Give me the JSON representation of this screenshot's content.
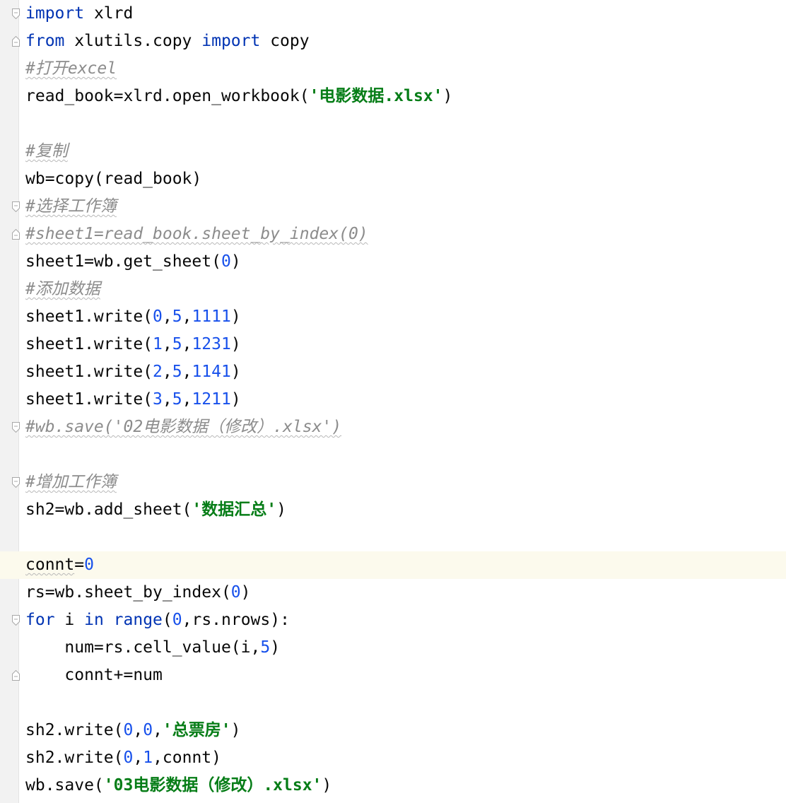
{
  "editor": {
    "lines": [
      {
        "fold": "start",
        "current": false,
        "tokens": [
          {
            "t": "import",
            "c": "kw"
          },
          {
            "t": " xlrd",
            "c": "plain"
          }
        ]
      },
      {
        "fold": "end",
        "current": false,
        "tokens": [
          {
            "t": "from",
            "c": "kw"
          },
          {
            "t": " xlutils.copy ",
            "c": "plain"
          },
          {
            "t": "import",
            "c": "kw"
          },
          {
            "t": " copy",
            "c": "plain"
          }
        ]
      },
      {
        "fold": "",
        "current": false,
        "tokens": [
          {
            "t": "#打开excel",
            "c": "cmt wavy"
          }
        ]
      },
      {
        "fold": "",
        "current": false,
        "tokens": [
          {
            "t": "read_book=xlrd.open_workbook(",
            "c": "plain"
          },
          {
            "t": "'电影数据.xlsx'",
            "c": "str"
          },
          {
            "t": ")",
            "c": "plain"
          }
        ]
      },
      {
        "fold": "",
        "current": false,
        "tokens": []
      },
      {
        "fold": "",
        "current": false,
        "tokens": [
          {
            "t": "#复制",
            "c": "cmt wavy"
          }
        ]
      },
      {
        "fold": "",
        "current": false,
        "tokens": [
          {
            "t": "wb=copy(read_book)",
            "c": "plain"
          }
        ]
      },
      {
        "fold": "start",
        "current": false,
        "tokens": [
          {
            "t": "#选择工作簿",
            "c": "cmt wavy"
          }
        ]
      },
      {
        "fold": "end",
        "current": false,
        "tokens": [
          {
            "t": "#sheet1=read_book.sheet_by_index(0)",
            "c": "cmt wavy"
          }
        ]
      },
      {
        "fold": "",
        "current": false,
        "tokens": [
          {
            "t": "sheet1=wb.get_sheet(",
            "c": "plain"
          },
          {
            "t": "0",
            "c": "num"
          },
          {
            "t": ")",
            "c": "plain"
          }
        ]
      },
      {
        "fold": "",
        "current": false,
        "tokens": [
          {
            "t": "#添加数据",
            "c": "cmt wavy"
          }
        ]
      },
      {
        "fold": "",
        "current": false,
        "tokens": [
          {
            "t": "sheet1.write(",
            "c": "plain"
          },
          {
            "t": "0",
            "c": "num"
          },
          {
            "t": ",",
            "c": "plain"
          },
          {
            "t": "5",
            "c": "num"
          },
          {
            "t": ",",
            "c": "plain"
          },
          {
            "t": "1111",
            "c": "num"
          },
          {
            "t": ")",
            "c": "plain"
          }
        ]
      },
      {
        "fold": "",
        "current": false,
        "tokens": [
          {
            "t": "sheet1.write(",
            "c": "plain"
          },
          {
            "t": "1",
            "c": "num"
          },
          {
            "t": ",",
            "c": "plain"
          },
          {
            "t": "5",
            "c": "num"
          },
          {
            "t": ",",
            "c": "plain"
          },
          {
            "t": "1231",
            "c": "num"
          },
          {
            "t": ")",
            "c": "plain"
          }
        ]
      },
      {
        "fold": "",
        "current": false,
        "tokens": [
          {
            "t": "sheet1.write(",
            "c": "plain"
          },
          {
            "t": "2",
            "c": "num"
          },
          {
            "t": ",",
            "c": "plain"
          },
          {
            "t": "5",
            "c": "num"
          },
          {
            "t": ",",
            "c": "plain"
          },
          {
            "t": "1141",
            "c": "num"
          },
          {
            "t": ")",
            "c": "plain"
          }
        ]
      },
      {
        "fold": "",
        "current": false,
        "tokens": [
          {
            "t": "sheet1.write(",
            "c": "plain"
          },
          {
            "t": "3",
            "c": "num"
          },
          {
            "t": ",",
            "c": "plain"
          },
          {
            "t": "5",
            "c": "num"
          },
          {
            "t": ",",
            "c": "plain"
          },
          {
            "t": "1211",
            "c": "num"
          },
          {
            "t": ")",
            "c": "plain"
          }
        ]
      },
      {
        "fold": "single",
        "current": false,
        "tokens": [
          {
            "t": "#wb.save('02电影数据（修改）.xlsx')",
            "c": "cmt wavy"
          }
        ]
      },
      {
        "fold": "",
        "current": false,
        "tokens": []
      },
      {
        "fold": "single",
        "current": false,
        "tokens": [
          {
            "t": "#增加工作簿",
            "c": "cmt wavy"
          }
        ]
      },
      {
        "fold": "",
        "current": false,
        "tokens": [
          {
            "t": "sh2=wb.add_sheet(",
            "c": "plain"
          },
          {
            "t": "'数据汇总'",
            "c": "str"
          },
          {
            "t": ")",
            "c": "plain"
          }
        ]
      },
      {
        "fold": "",
        "current": false,
        "tokens": []
      },
      {
        "fold": "",
        "current": true,
        "tokens": [
          {
            "t": "connt",
            "c": "plain wavy"
          },
          {
            "t": "=",
            "c": "plain"
          },
          {
            "t": "0",
            "c": "num"
          }
        ]
      },
      {
        "fold": "",
        "current": false,
        "tokens": [
          {
            "t": "rs=wb.sheet_by_index(",
            "c": "plain"
          },
          {
            "t": "0",
            "c": "num"
          },
          {
            "t": ")",
            "c": "plain"
          }
        ]
      },
      {
        "fold": "start",
        "current": false,
        "tokens": [
          {
            "t": "for",
            "c": "kw"
          },
          {
            "t": " i ",
            "c": "plain"
          },
          {
            "t": "in",
            "c": "kw"
          },
          {
            "t": " ",
            "c": "plain"
          },
          {
            "t": "range",
            "c": "kw"
          },
          {
            "t": "(",
            "c": "plain"
          },
          {
            "t": "0",
            "c": "num"
          },
          {
            "t": ",rs.nrows):",
            "c": "plain"
          }
        ]
      },
      {
        "fold": "",
        "current": false,
        "tokens": [
          {
            "t": "    num=rs.cell_value(i,",
            "c": "plain"
          },
          {
            "t": "5",
            "c": "num"
          },
          {
            "t": ")",
            "c": "plain"
          }
        ]
      },
      {
        "fold": "end",
        "current": false,
        "tokens": [
          {
            "t": "    connt+=num",
            "c": "plain"
          }
        ]
      },
      {
        "fold": "",
        "current": false,
        "tokens": []
      },
      {
        "fold": "",
        "current": false,
        "tokens": [
          {
            "t": "sh2.write(",
            "c": "plain"
          },
          {
            "t": "0",
            "c": "num"
          },
          {
            "t": ",",
            "c": "plain"
          },
          {
            "t": "0",
            "c": "num"
          },
          {
            "t": ",",
            "c": "plain"
          },
          {
            "t": "'总票房'",
            "c": "str"
          },
          {
            "t": ")",
            "c": "plain"
          }
        ]
      },
      {
        "fold": "",
        "current": false,
        "tokens": [
          {
            "t": "sh2.write(",
            "c": "plain"
          },
          {
            "t": "0",
            "c": "num"
          },
          {
            "t": ",",
            "c": "plain"
          },
          {
            "t": "1",
            "c": "num"
          },
          {
            "t": ",connt)",
            "c": "plain"
          }
        ]
      },
      {
        "fold": "",
        "current": false,
        "tokens": [
          {
            "t": "wb.save(",
            "c": "plain"
          },
          {
            "t": "'03电影数据（修改）.xlsx'",
            "c": "str"
          },
          {
            "t": ")",
            "c": "plain"
          }
        ]
      }
    ]
  }
}
